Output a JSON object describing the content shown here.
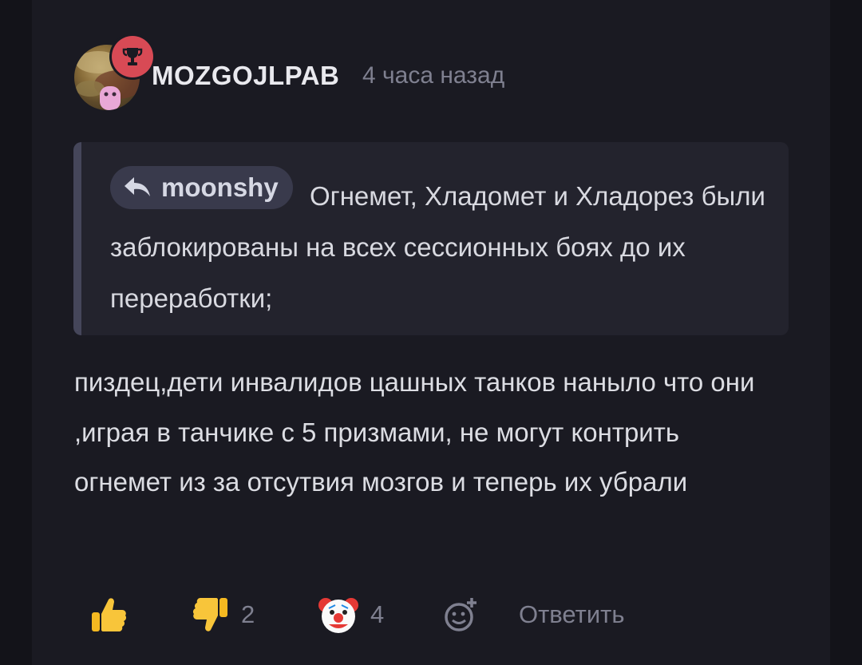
{
  "comment": {
    "author": "MOZGOJLPAB",
    "time": "4 часа назад",
    "quote": {
      "author": "moonshy",
      "text": "Огнемет, Хладомет и Хладорез были заблокированы на всех сессионных боях до их переработки;"
    },
    "body": "пиздец,дети инвалидов цашных танков наныло что они ,играя в танчике с 5 призмами, не могут контрить огнемет из за отсутвия мозгов и теперь их убрали"
  },
  "actions": {
    "like_icon": "thumbs-up-icon",
    "dislike_icon": "thumbs-down-icon",
    "dislike_count": "2",
    "clown_icon": "clown-face-icon",
    "clown_count": "4",
    "add_reaction_icon": "add-reaction-icon",
    "reply_label": "Ответить"
  },
  "colors": {
    "background": "#131319",
    "card": "#1a1a22",
    "quote_bg": "#23232d",
    "quote_border": "#45465a",
    "badge": "#d84a55",
    "muted_text": "#7f8090",
    "text": "#dcdde3"
  }
}
